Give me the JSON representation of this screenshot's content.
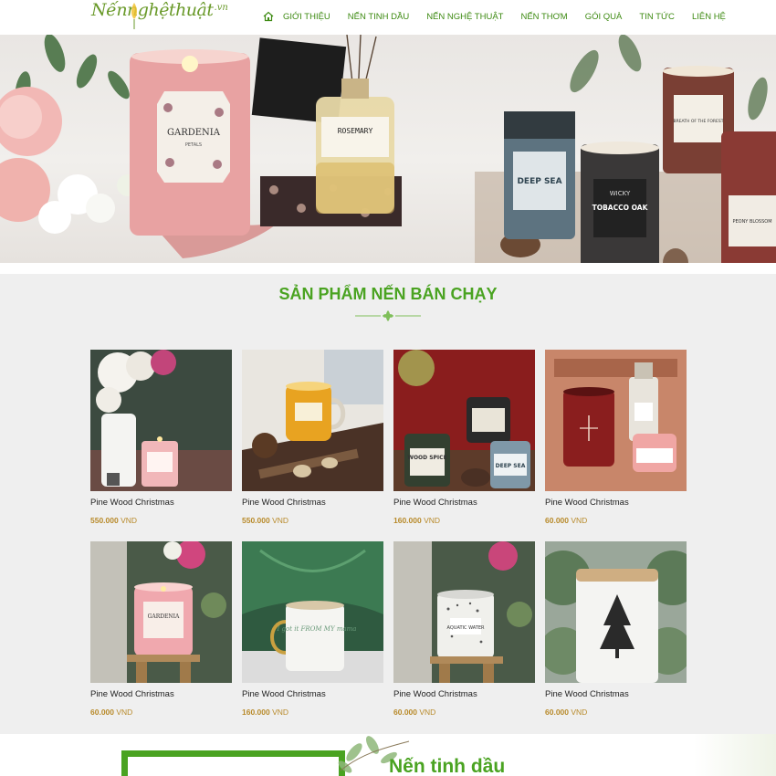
{
  "brand": {
    "logo_text": "Nếnnghệthuật",
    "logo_ext": ".vn",
    "accent": "#4aa321",
    "price_color": "#b88a2a"
  },
  "nav": {
    "home_icon": "home-icon",
    "items": [
      {
        "label": "Giới thiệu"
      },
      {
        "label": "Nến tinh dầu"
      },
      {
        "label": "Nến nghệ thuật"
      },
      {
        "label": "Nến thơm"
      },
      {
        "label": "Gói quà"
      },
      {
        "label": "Tin tức"
      },
      {
        "label": "Liên hệ"
      }
    ]
  },
  "banner": {
    "labels": {
      "gardenia": "GARDENIA",
      "petals": "PETALS",
      "rosemary": "ROSEMARY",
      "deep_sea": "DEEP SEA",
      "tobacco_oak": "TOBACCO OAK",
      "wicky": "WICKY",
      "peony_blossom": "PEONY BLOSSOM",
      "breath_forest": "BREATH OF THE FOREST"
    }
  },
  "products_section": {
    "title": "SẢN PHẨM NẾN BÁN CHẠY",
    "currency": "VND",
    "items": [
      {
        "name": "Pine Wood Christmas",
        "price": "550.000",
        "image": "candle-flowers"
      },
      {
        "name": "Pine Wood Christmas",
        "price": "550.000",
        "image": "candle-amber-pinecone"
      },
      {
        "name": "Pine Wood Christmas",
        "price": "160.000",
        "image": "candles-wood-spice"
      },
      {
        "name": "Pine Wood Christmas",
        "price": "60.000",
        "image": "candle-gift-box"
      },
      {
        "name": "Pine Wood Christmas",
        "price": "60.000",
        "image": "candle-gardenia-lantern"
      },
      {
        "name": "Pine Wood Christmas",
        "price": "160.000",
        "image": "mug-from-my-mama"
      },
      {
        "name": "Pine Wood Christmas",
        "price": "60.000",
        "image": "candle-aquatic-water"
      },
      {
        "name": "Pine Wood Christmas",
        "price": "60.000",
        "image": "candle-pine-tree"
      }
    ],
    "image_texts": {
      "wood_spice": "WOOD SPICE",
      "deep_sea": "DEEP SEA",
      "gardenia": "GARDENIA",
      "got_it_from_my_mama": "I got it FROM MY mama",
      "aquatic_water": "AQUATIC WATER"
    }
  },
  "teaser": {
    "title": "Nến tinh dầu"
  }
}
